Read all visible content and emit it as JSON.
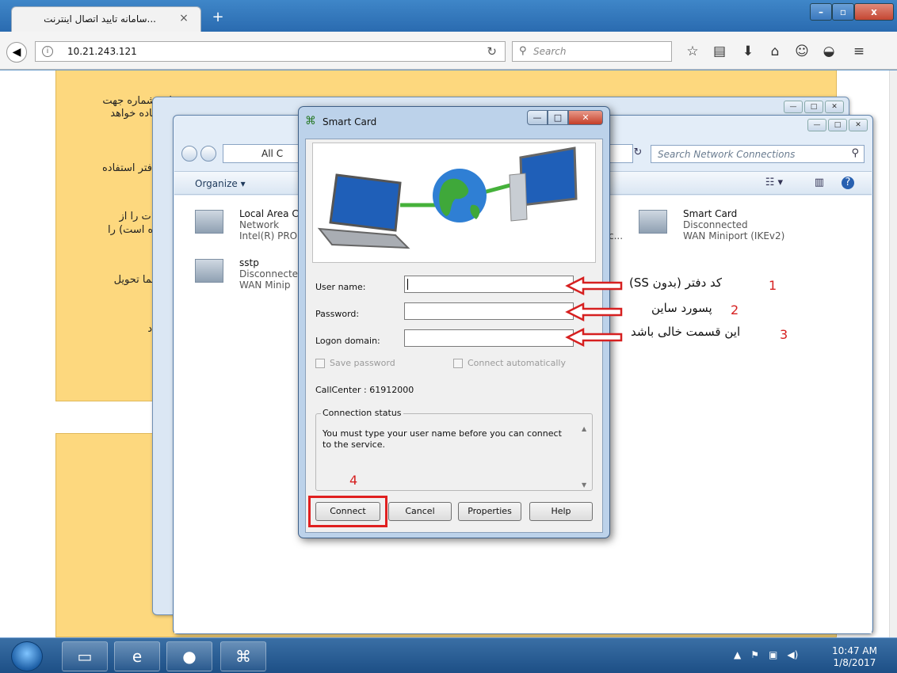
{
  "browser": {
    "tab_title": "...سامانه تایید اتصال اینترنت",
    "tab_close": "×",
    "new_tab": "+",
    "url": "10.21.243.121",
    "search_placeholder": "Search"
  },
  "page": {
    "fa_lines": [
      "این شماره جهت",
      "استفاده خواهد",
      "فتر استفاده",
      "ینترنات را از",
      "نموده است) را",
      "به شما تحویل",
      "د"
    ]
  },
  "network_window": {
    "address_text": "All C",
    "search_placeholder": "Search Network Connections",
    "organize_label": "Organize ▾",
    "connections": [
      {
        "name": "Local Area C",
        "status": "Network",
        "device": "Intel(R) PRO"
      },
      {
        "name": "sstp",
        "status": "Disconnecte",
        "device": "WAN Minip"
      },
      {
        "name": "Smart Card",
        "status": "Disconnected",
        "device": "WAN Miniport (IKEv2)"
      }
    ],
    "truncation_char": "c..."
  },
  "dialog": {
    "title": "Smart Card",
    "username_label": "User name:",
    "password_label": "Password:",
    "domain_label": "Logon domain:",
    "username_value": "",
    "password_value": "",
    "domain_value": "",
    "save_password_label": "Save password",
    "connect_auto_label": "Connect automatically",
    "callcenter_text": "CallCenter : 61912000",
    "status_legend": "Connection status",
    "status_message": "You must type your user name before you can connect to the service.",
    "buttons": {
      "connect": "Connect",
      "cancel": "Cancel",
      "properties": "Properties",
      "help": "Help"
    }
  },
  "annotations": {
    "n1": "1",
    "n2": "2",
    "n3": "3",
    "n4": "4",
    "a1": "کد دفتر (بدون SS)",
    "a2": "پسورد ساین",
    "a3": "این قسمت خالی باشد",
    "arrow_color": "#d62020"
  },
  "taskbar": {
    "time": "10:47 AM",
    "date": "1/8/2017"
  }
}
